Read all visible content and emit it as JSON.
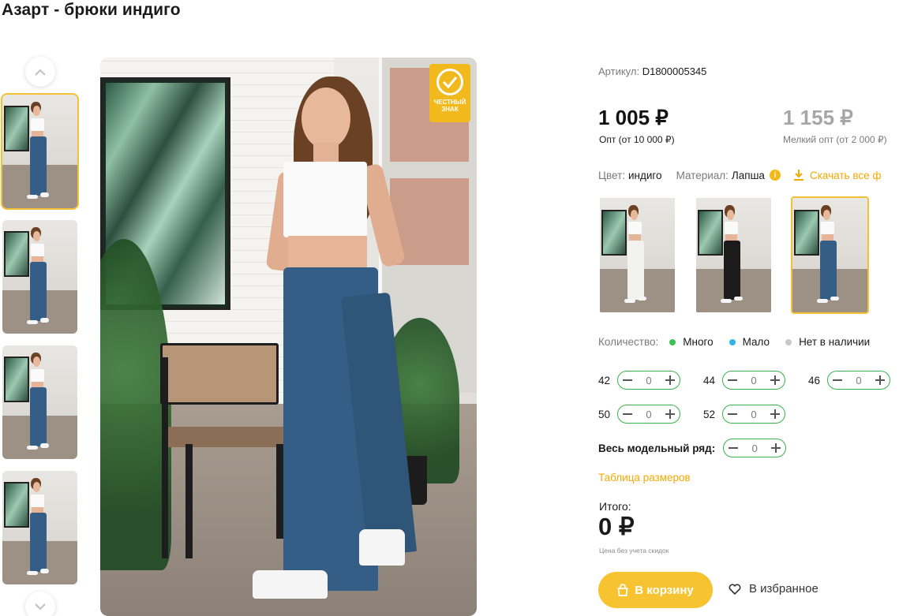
{
  "product": {
    "title": "Азарт - брюки индиго",
    "sku_label": "Артикул:",
    "sku_value": "D1800005345"
  },
  "badge": {
    "text": "ЧЕСТНЫЙ ЗНАК"
  },
  "prices": {
    "wholesale": "1 005 ₽",
    "wholesale_note": "Опт (от 10 000 ₽)",
    "small": "1 155 ₽",
    "small_note": "Мелкий опт (от 2 000 ₽)"
  },
  "attributes": {
    "color_label": "Цвет:",
    "color_value": "индиго",
    "material_label": "Материал:",
    "material_value": "Лапша",
    "info_glyph": "i",
    "download_label": "Скачать все ф"
  },
  "variants": [
    {
      "name": "white",
      "pants_color": "#f2f2ee",
      "bg": "#9a9a9a"
    },
    {
      "name": "black",
      "pants_color": "#1b1b1b",
      "bg": "#8e8e8e"
    },
    {
      "name": "indigo",
      "pants_color": "#355e86",
      "bg": "#d9d7d2",
      "active": true
    }
  ],
  "stock_legend": {
    "label": "Количество:",
    "items": [
      {
        "label": "Много",
        "color": "#3cc04f"
      },
      {
        "label": "Мало",
        "color": "#2bb8e8"
      },
      {
        "label": "Нет в наличии",
        "color": "#c8c8c8"
      }
    ]
  },
  "sizes": [
    {
      "size": "42",
      "qty": "0"
    },
    {
      "size": "44",
      "qty": "0"
    },
    {
      "size": "46",
      "qty": "0"
    },
    {
      "size": "50",
      "qty": "0"
    },
    {
      "size": "52",
      "qty": "0"
    }
  ],
  "all_sizes": {
    "label": "Весь модельный ряд:",
    "qty": "0"
  },
  "size_table_link": "Таблица размеров",
  "total": {
    "label": "Итого:",
    "value": "0 ₽",
    "note": "Цена без учета скидок"
  },
  "actions": {
    "cart": "В корзину",
    "favorite": "В избранное"
  },
  "colors": {
    "accent": "#f7c330",
    "link": "#f5a800",
    "stepper_border": "#38b24a",
    "product_indigo": "#355e86"
  },
  "icons": [
    "chevron-up-icon",
    "chevron-down-icon",
    "check-icon",
    "info-icon",
    "download-icon",
    "minus-icon",
    "plus-icon",
    "bag-icon",
    "heart-icon"
  ]
}
